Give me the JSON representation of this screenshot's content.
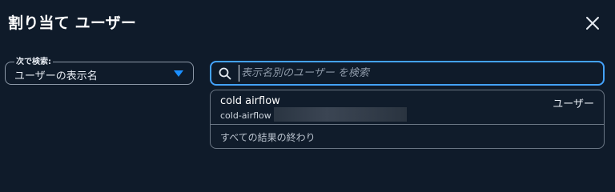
{
  "modal": {
    "title": "割り当て ユーザー",
    "close_icon": "close-icon"
  },
  "search_by": {
    "label": "次で検索:",
    "value": "ユーザーの表示名",
    "caret_color": "#1b8fff"
  },
  "search": {
    "icon": "search-icon",
    "placeholder": "表示名別のユーザー を検索",
    "value": "",
    "border_color": "#44a3ff"
  },
  "results": {
    "items": [
      {
        "name": "cold airflow",
        "type": "ユーザー",
        "sub": "cold-airflow |"
      }
    ],
    "footer": "すべての結果の終わり"
  },
  "colors": {
    "background": "#0f1b2a",
    "accent": "#44a3ff"
  }
}
